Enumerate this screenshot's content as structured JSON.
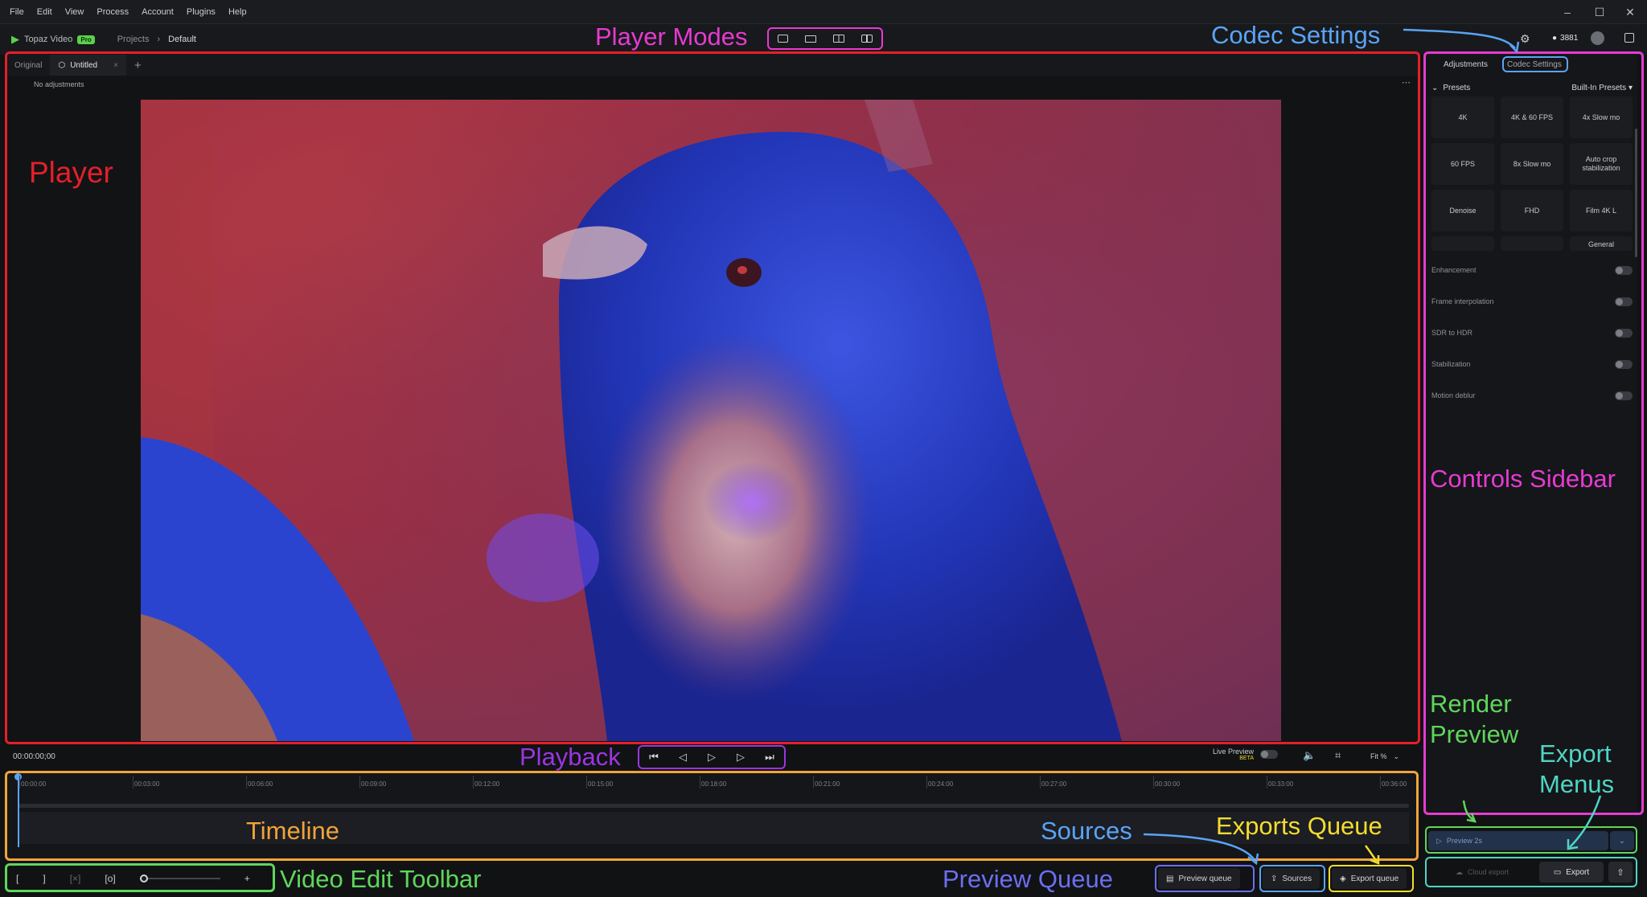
{
  "menu": [
    "File",
    "Edit",
    "View",
    "Process",
    "Account",
    "Plugins",
    "Help"
  ],
  "window_controls": {
    "minimize": "–",
    "maximize": "☐",
    "close": "✕"
  },
  "app": {
    "name": "Topaz Video",
    "badge": "Pro",
    "credits": "3881"
  },
  "breadcrumb": {
    "root": "Projects",
    "sep": "›",
    "current": "Default"
  },
  "tabs": {
    "original": "Original",
    "untitled": "Untitled",
    "add": "+"
  },
  "subbar": {
    "status": "No adjustments",
    "more": "⋯"
  },
  "sidebar": {
    "tab_adjustments": "Adjustments",
    "tab_codec": "Codec Settings",
    "presets_label": "Presets",
    "presets_source": "Built-In Presets",
    "presets": [
      "4K",
      "4K & 60 FPS",
      "4x Slow mo",
      "60 FPS",
      "8x Slow mo",
      "Auto crop stabilization",
      "Denoise",
      "FHD",
      "Film 4K L",
      "",
      "",
      "General"
    ],
    "toggles": [
      "Enhancement",
      "Frame interpolation",
      "SDR to HDR",
      "Stabilization",
      "Motion deblur"
    ]
  },
  "playback": {
    "timecode": "00:00:00;00",
    "live_preview": "Live Preview",
    "beta": "BETA",
    "zoom": "Fit %"
  },
  "timeline_ticks": [
    "00:00:00",
    "00:03:00",
    "00:06:00",
    "00:09:00",
    "00:12:00",
    "00:15:00",
    "00:18:00",
    "00:21:00",
    "00:24:00",
    "00:27:00",
    "00:30:00",
    "00:33:00",
    "00:36:00"
  ],
  "toolbar": {
    "zoom_plus": "+"
  },
  "buttons": {
    "preview_queue": "Preview queue",
    "sources": "Sources",
    "export_queue": "Export queue",
    "preview": "Preview 2s",
    "cloud_export": "Cloud export",
    "export": "Export"
  },
  "annotations": {
    "player_modes": "Player Modes",
    "codec_settings": "Codec Settings",
    "player": "Player",
    "controls_sidebar": "Controls Sidebar",
    "render_preview_1": "Render",
    "render_preview_2": "Preview",
    "export_menus_1": "Export",
    "export_menus_2": "Menus",
    "playback": "Playback",
    "timeline": "Timeline",
    "sources": "Sources",
    "exports_queue": "Exports Queue",
    "video_edit_toolbar": "Video Edit Toolbar",
    "preview_queue": "Preview Queue"
  },
  "colors": {
    "red": "#e3202a",
    "pink": "#e63bd1",
    "blue": "#5aa4f5",
    "purple": "#9b36e0",
    "orange": "#f0a43a",
    "green": "#5fd65b",
    "yellow": "#f4dd2e",
    "teal": "#4fd5c4",
    "indigo": "#6b6ff0"
  }
}
